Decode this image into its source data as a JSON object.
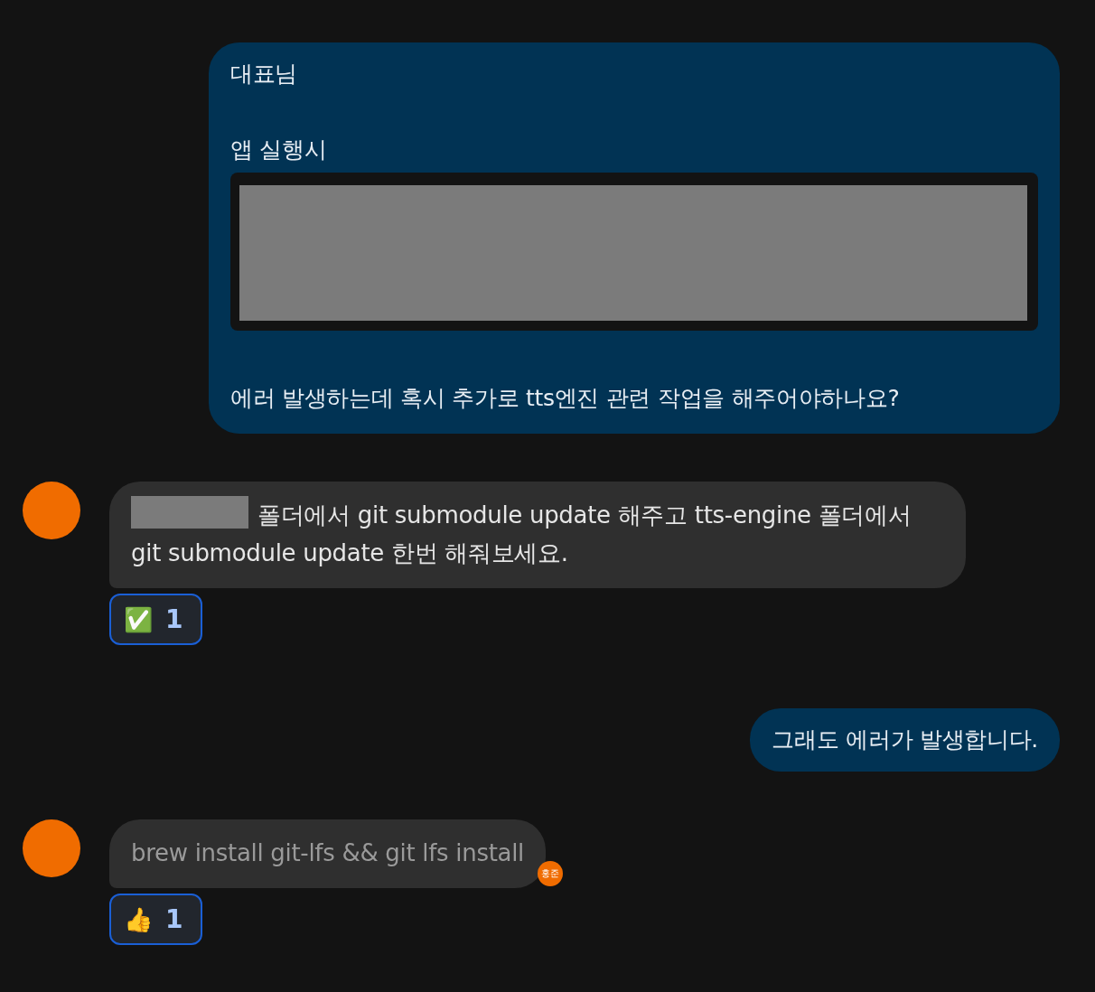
{
  "messages": [
    {
      "kind": "sent",
      "parts": [
        {
          "kind": "text",
          "text": "대표님"
        },
        {
          "kind": "gap"
        },
        {
          "kind": "text",
          "text": "앱 실행시"
        },
        {
          "kind": "redacted-code"
        },
        {
          "kind": "gap"
        },
        {
          "kind": "text",
          "text": "에러 발생하는데 혹시 추가로 tts엔진 관련 작업을 해주어야하나요?"
        }
      ]
    },
    {
      "kind": "received",
      "pending": false,
      "redacted_prefix": true,
      "text": "폴더에서 git submodule update 해주고 tts-engine 폴더에서 git submodule update 한번 해줘보세요.",
      "reaction": {
        "emoji": "✅",
        "count": "1"
      }
    },
    {
      "kind": "sent",
      "parts": [
        {
          "kind": "text",
          "text": "그래도 에러가 발생합니다."
        }
      ]
    },
    {
      "kind": "received",
      "pending": true,
      "text": "brew install git-lfs && git lfs install",
      "read_by": "홍준",
      "reaction": {
        "emoji": "👍",
        "count": "1"
      }
    }
  ]
}
